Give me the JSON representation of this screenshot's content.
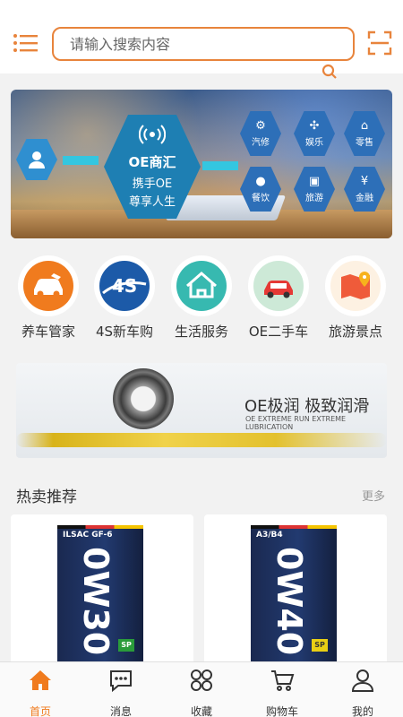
{
  "header": {
    "search_placeholder": "请输入搜索内容"
  },
  "banner": {
    "center_title": "OE商汇",
    "center_line1": "携手OE",
    "center_line2": "尊享人生",
    "services": [
      "汽修",
      "娱乐",
      "零售",
      "餐饮",
      "旅游",
      "金融"
    ]
  },
  "categories": [
    {
      "label": "养车管家",
      "icon": "car-care-icon"
    },
    {
      "label": "4S新车购",
      "icon": "4s-icon"
    },
    {
      "label": "生活服务",
      "icon": "house-icon"
    },
    {
      "label": "OE二手车",
      "icon": "used-car-icon"
    },
    {
      "label": "旅游景点",
      "icon": "map-pin-icon"
    }
  ],
  "promo": {
    "title": "OE极润 极致润滑",
    "subtitle": "OE EXTREME RUN EXTREME LUBRICATION"
  },
  "hot": {
    "title": "热卖推荐",
    "more": "更多",
    "products": [
      {
        "standard": "ILSAC GF-6",
        "grade": "0W30",
        "badge": "SP"
      },
      {
        "standard": "A3/B4",
        "grade": "0W40",
        "badge": "SP"
      }
    ]
  },
  "tabs": [
    {
      "label": "首页",
      "icon": "home-icon",
      "active": true
    },
    {
      "label": "消息",
      "icon": "message-icon",
      "active": false
    },
    {
      "label": "收藏",
      "icon": "grid-icon",
      "active": false
    },
    {
      "label": "购物车",
      "icon": "cart-icon",
      "active": false
    },
    {
      "label": "我的",
      "icon": "user-icon",
      "active": false
    }
  ],
  "colors": {
    "accent": "#f07b1e",
    "search_border": "#e8843c"
  }
}
